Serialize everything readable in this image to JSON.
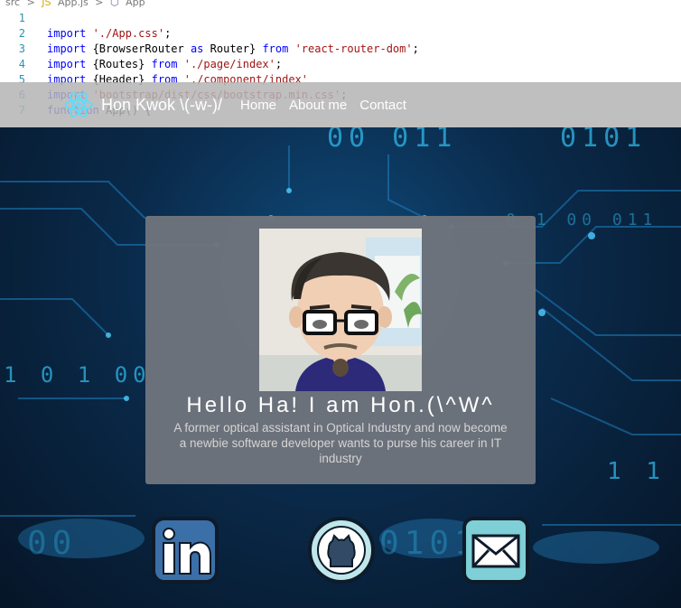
{
  "editor": {
    "breadcrumbs": [
      "src",
      ">",
      "App.js",
      ">",
      "App"
    ],
    "lines": [
      {
        "num": "1",
        "parts": []
      },
      {
        "num": "2",
        "parts": [
          {
            "t": "import ",
            "c": "kw"
          },
          {
            "t": "'./App.css'",
            "c": "str"
          },
          {
            "t": ";",
            "c": "plain"
          }
        ]
      },
      {
        "num": "3",
        "parts": [
          {
            "t": "import ",
            "c": "kw"
          },
          {
            "t": "{BrowserRouter ",
            "c": "plain"
          },
          {
            "t": "as ",
            "c": "kw"
          },
          {
            "t": "Router} ",
            "c": "plain"
          },
          {
            "t": "from ",
            "c": "kw"
          },
          {
            "t": "'react-router-dom'",
            "c": "str"
          },
          {
            "t": ";",
            "c": "plain"
          }
        ]
      },
      {
        "num": "4",
        "parts": [
          {
            "t": "import ",
            "c": "kw"
          },
          {
            "t": "{Routes} ",
            "c": "plain"
          },
          {
            "t": "from ",
            "c": "kw"
          },
          {
            "t": "'./page/index'",
            "c": "str"
          },
          {
            "t": ";",
            "c": "plain"
          }
        ]
      },
      {
        "num": "5",
        "parts": [
          {
            "t": "import ",
            "c": "kw"
          },
          {
            "t": "{Header} ",
            "c": "plain"
          },
          {
            "t": "from ",
            "c": "kw"
          },
          {
            "t": "'./component/index'",
            "c": "str"
          }
        ]
      },
      {
        "num": "6",
        "parts": [
          {
            "t": "import ",
            "c": "kw"
          },
          {
            "t": "'bootstrap/dist/css/bootstrap.min.css'",
            "c": "str"
          },
          {
            "t": ";",
            "c": "plain"
          }
        ]
      },
      {
        "num": "7",
        "parts": [
          {
            "t": "function ",
            "c": "kw"
          },
          {
            "t": "App() {",
            "c": "plain"
          }
        ]
      }
    ]
  },
  "navbar": {
    "brand": "Hon Kwok \\(-w-)/",
    "links": [
      "Home",
      "About me",
      "Contact"
    ],
    "logo_icon": "react-logo-icon",
    "background": "#b4b4b4"
  },
  "hero": {
    "binary": [
      "00  011",
      "0101",
      "1 0 1  00",
      "0 1  00  011",
      "1 1",
      "00",
      "0101"
    ]
  },
  "card": {
    "greeting": "Hello Ha! I am Hon.(\\^W^",
    "bio": "A former optical assistant in Optical Industry and now become a newbie software developer wants to purse his career in IT industry"
  },
  "social": [
    {
      "name": "linkedin-icon",
      "glyph": "in"
    },
    {
      "name": "github-icon"
    },
    {
      "name": "mail-icon"
    }
  ],
  "colors": {
    "accent": "#2fb8e8",
    "card": "#6e747c",
    "linkedin": "#3b6fa8",
    "mail": "#7ecfd6"
  }
}
